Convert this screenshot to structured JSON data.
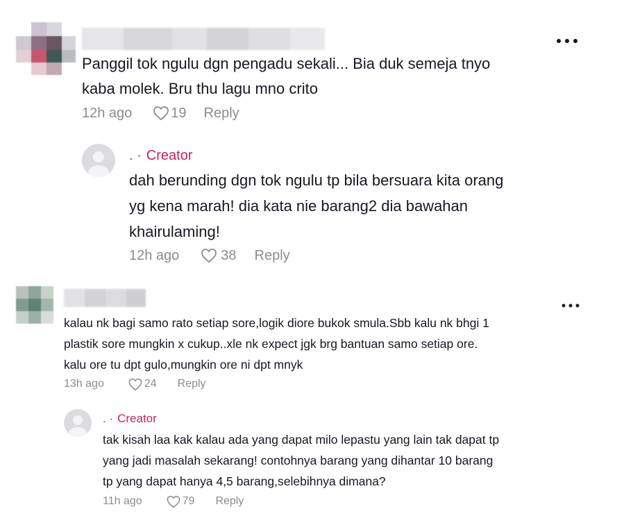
{
  "comments": [
    {
      "text_lines": [
        "Panggil tok ngulu dgn pengadu sekali... Bia duk semeja tnyo",
        "kaba molek. Bru thu lagu mno crito"
      ],
      "time": "12h ago",
      "likes": "19",
      "reply_label": "Reply",
      "more_icon": "more-horizontal-icon",
      "reply": {
        "author_prefix": ". ·",
        "author_badge": "Creator",
        "text_lines": [
          "dah berunding dgn tok ngulu tp bila bersuara kita orang",
          "yg kena marah! dia kata nie barang2 dia bawahan",
          "khairulaming!"
        ],
        "time": "12h ago",
        "likes": "38",
        "reply_label": "Reply"
      }
    },
    {
      "text_lines": [
        "kalau nk bagi samo rato setiap sore,logik diore bukok smula.Sbb kalu nk bhgi 1",
        "plastik sore mungkin x cukup..xle nk expect jgk brg bantuan samo setiap ore.",
        "kalu ore tu dpt gulo,mungkin ore ni dpt mnyk"
      ],
      "time": "13h ago",
      "likes": "24",
      "reply_label": "Reply",
      "more_icon": "more-horizontal-icon",
      "reply": {
        "author_prefix": ". ·",
        "author_badge": "Creator",
        "text_lines": [
          "tak kisah laa kak kalau ada yang dapat milo lepastu yang lain tak dapat tp",
          "yang jadi masalah sekarang! contohnya barang yang dihantar 10 barang",
          "tp yang dapat hanya 4,5 barang,selebihnya dimana?"
        ],
        "time": "11h ago",
        "likes": "79",
        "reply_label": "Reply"
      }
    }
  ],
  "colors": {
    "creator_badge": "#c8215a",
    "meta_text": "#8a8b91",
    "body_text": "#161823"
  }
}
